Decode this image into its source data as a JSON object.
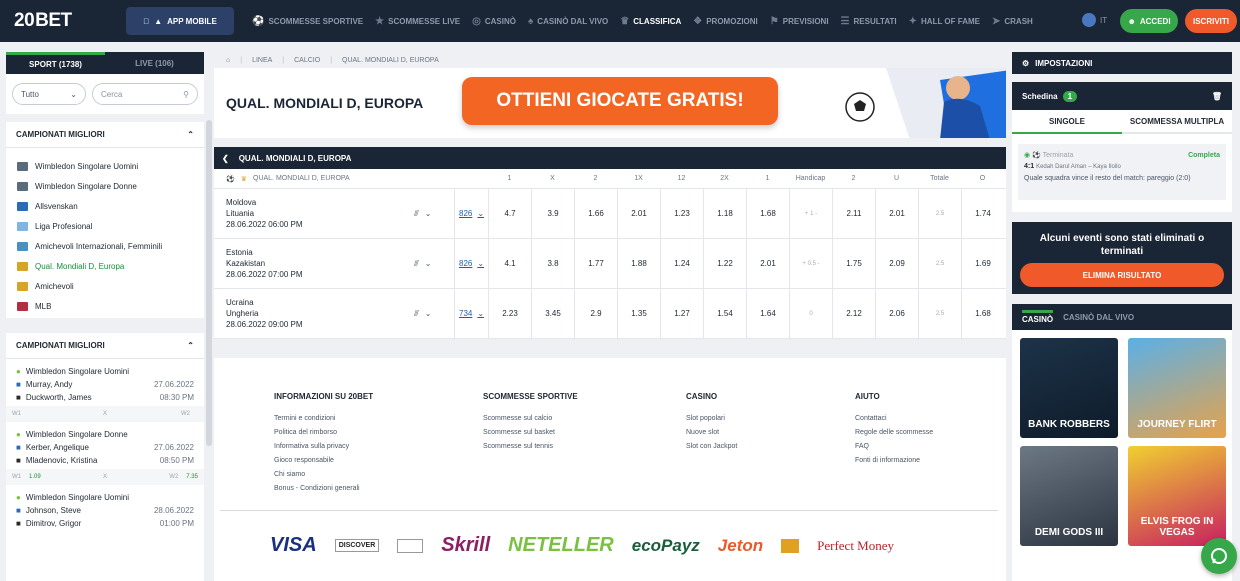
{
  "nav": {
    "logo_num": "20",
    "logo_word": "BET",
    "app_mobile": "APP MOBILE",
    "items": [
      {
        "label": "SCOMMESSE SPORTIVE",
        "icon": "soccer-ball-icon"
      },
      {
        "label": "SCOMMESSE LIVE",
        "icon": "live-icon"
      },
      {
        "label": "CASINÒ",
        "icon": "chip-icon"
      },
      {
        "label": "CASINÒ DAL VIVO",
        "icon": "cards-icon"
      },
      {
        "label": "CLASSIFICA",
        "icon": "trophy-icon"
      },
      {
        "label": "PROMOZIONI",
        "icon": "gift-icon"
      },
      {
        "label": "PREVISIONI",
        "icon": "forecast-icon"
      },
      {
        "label": "RESULTATI",
        "icon": "results-icon"
      },
      {
        "label": "HALL OF FAME",
        "icon": "hall-icon"
      },
      {
        "label": "CRASH",
        "icon": "rocket-icon"
      }
    ],
    "lang": "IT",
    "login": "ACCEDI",
    "register": "ISCRIVITI"
  },
  "sidebar": {
    "tab_sport": "SPORT (1738)",
    "tab_live": "LIVE (106)",
    "filter_value": "Tutto",
    "search_placeholder": "Cerca",
    "top_leagues_title": "CAMPIONATI MIGLIORI",
    "leagues": [
      {
        "label": "Wimbledon Singolare Uomini",
        "color": "#5a6b7c"
      },
      {
        "label": "Wimbledon Singolare Donne",
        "color": "#5a6b7c"
      },
      {
        "label": "Allsvenskan",
        "color": "#2b6bb5"
      },
      {
        "label": "Liga Profesional",
        "color": "#7fb4e3"
      },
      {
        "label": "Amichevoli Internazionali, Femminili",
        "color": "#4a90c0"
      },
      {
        "label": "Qual. Mondiali D, Europa",
        "color": "#d4a52a"
      },
      {
        "label": "Amichevoli",
        "color": "#d4a52a"
      },
      {
        "label": "MLB",
        "color": "#b03040"
      }
    ],
    "top_matches_title": "CAMPIONATI MIGLIORI",
    "matches": [
      {
        "league": "Wimbledon Singolare Uomini",
        "p1": "Murray, Andy",
        "p2": "Duckworth, James",
        "date": "27.06.2022",
        "time": "08:30 PM",
        "w1": "W1",
        "x": "X",
        "w2": "W2",
        "o1": "",
        "o2": ""
      },
      {
        "league": "Wimbledon Singolare Donne",
        "p1": "Kerber, Angelique",
        "p2": "Mladenovic, Kristina",
        "date": "27.06.2022",
        "time": "08:50 PM",
        "w1": "W1",
        "x": "X",
        "w2": "W2",
        "o1": "1.09",
        "o2": "7.35"
      },
      {
        "league": "Wimbledon Singolare Uomini",
        "p1": "Johnson, Steve",
        "p2": "Dimitrov, Grigor",
        "date": "28.06.2022",
        "time": "01:00 PM",
        "w1": "",
        "x": "",
        "w2": "",
        "o1": "",
        "o2": ""
      }
    ]
  },
  "breadcrumb": [
    "LINEA",
    "CALCIO",
    "QUAL. MONDIALI D, EUROPA"
  ],
  "banner": {
    "title": "QUAL. MONDIALI D, EUROPA",
    "promo": "OTTIENI GIOCATE GRATIS!"
  },
  "events": {
    "title": "QUAL. MONDIALI D, EUROPA",
    "group_label": "QUAL. MONDIALI D, EUROPA",
    "columns": [
      "1",
      "X",
      "2",
      "1X",
      "12",
      "2X",
      "1",
      "Handicap",
      "2",
      "U",
      "Totale",
      "O"
    ],
    "rows": [
      {
        "home": "Moldova",
        "away": "Lituania",
        "date": "28.06.2022 06:00 PM",
        "count": "826",
        "odds": [
          "4.7",
          "3.9",
          "1.66",
          "2.01",
          "1.23",
          "1.18",
          "1.68",
          "+ 1 -",
          "2.11",
          "2.01",
          "2.5",
          "1.74"
        ]
      },
      {
        "home": "Estonia",
        "away": "Kazakistan",
        "date": "28.06.2022 07:00 PM",
        "count": "826",
        "odds": [
          "4.1",
          "3.8",
          "1.77",
          "1.88",
          "1.24",
          "1.22",
          "2.01",
          "+ 0.5 -",
          "1.75",
          "2.09",
          "2.5",
          "1.69"
        ]
      },
      {
        "home": "Ucraina",
        "away": "Ungheria",
        "date": "28.06.2022 09:00 PM",
        "count": "734",
        "odds": [
          "2.23",
          "3.45",
          "2.9",
          "1.35",
          "1.27",
          "1.54",
          "1.64",
          "0",
          "2.12",
          "2.06",
          "2.5",
          "1.68"
        ]
      }
    ]
  },
  "footer": {
    "cols": [
      {
        "title": "INFORMAZIONI SU 20BET",
        "links": [
          "Termini e condizioni",
          "Politica del rimborso",
          "Informativa sulla privacy",
          "Gioco responsabile",
          "Chi siamo",
          "Bonus - Condizioni generali"
        ]
      },
      {
        "title": "SCOMMESSE SPORTIVE",
        "links": [
          "Scommesse sul calcio",
          "Scommesse sul basket",
          "Scommesse sul tennis"
        ]
      },
      {
        "title": "CASINO",
        "links": [
          "Slot popolari",
          "Nuove slot",
          "Slot con Jackpot"
        ]
      },
      {
        "title": "AIUTO",
        "links": [
          "Contattaci",
          "Regole delle scommesse",
          "FAQ",
          "Fonti di informazione"
        ]
      }
    ],
    "payments": [
      "VISA",
      "DISCOVER",
      "",
      "Skrill",
      "NETELLER",
      "ecoPayz",
      "Jeton",
      "",
      "Perfect Money"
    ]
  },
  "right": {
    "settings": "IMPOSTAZIONI",
    "betslip_title": "Schedina",
    "betslip_count": "1",
    "tab_single": "SINGOLE",
    "tab_multi": "SCOMMESSA MULTIPLA",
    "bet_status": "Terminata",
    "bet_result": "Completa",
    "bet_score": "4:1",
    "bet_teams": "Kedah Darul Aman – Kaya Iloilo",
    "bet_desc": "Quale squadra vince il resto del match: pareggio (2:0)",
    "removed_msg": "Alcuni eventi sono stati eliminati o terminati",
    "remove_btn": "ELIMINA RISULTATO",
    "casino_tab": "CASINÒ",
    "live_casino_tab": "CASINÒ DAL VIVO",
    "games": [
      "BANK ROBBERS",
      "JOURNEY FLIRT",
      "DEMI GODS III",
      "ELVIS FROG IN VEGAS"
    ]
  }
}
